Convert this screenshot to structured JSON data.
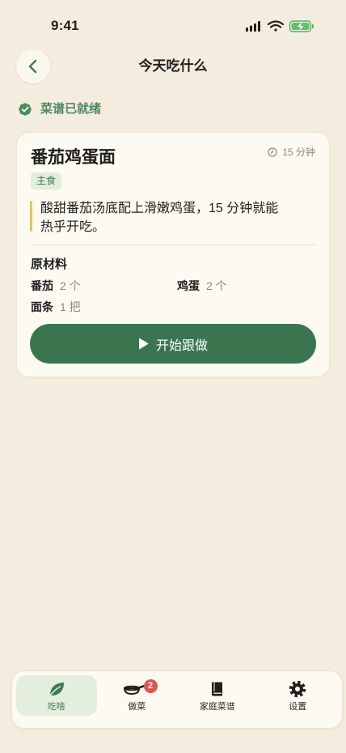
{
  "status_bar": {
    "time": "9:41",
    "icons": [
      "signal-icon",
      "wifi-icon",
      "battery-charging-icon"
    ]
  },
  "header": {
    "title": "今天吃什么",
    "back_icon": "chevron-left-icon"
  },
  "ready_status": {
    "text": "菜谱已就绪",
    "icon": "check-badge-icon"
  },
  "recipe": {
    "title": "番茄鸡蛋面",
    "time": "15 分钟",
    "time_icon": "clock-icon",
    "tag": "主食",
    "description": "酸甜番茄汤底配上滑嫩鸡蛋，15 分钟就能热乎开吃。",
    "ingredients_title": "原材料",
    "ingredients": [
      {
        "name": "番茄",
        "qty": "2 个"
      },
      {
        "name": "鸡蛋",
        "qty": "2 个"
      },
      {
        "name": "面条",
        "qty": "1 把"
      }
    ],
    "start_button": "开始跟做",
    "start_icon": "play-icon"
  },
  "tab_bar": {
    "items": [
      {
        "label": "吃啥",
        "icon": "leaf-icon",
        "active": true
      },
      {
        "label": "做菜",
        "icon": "frying-pan-icon",
        "badge": "2"
      },
      {
        "label": "家庭菜谱",
        "icon": "book-icon"
      },
      {
        "label": "设置",
        "icon": "gear-icon"
      }
    ]
  },
  "colors": {
    "background": "#F4EDDF",
    "card": "#FDFAF1",
    "accent": "#3A7550",
    "tag_bg": "#E2EDDB",
    "quote_bar": "#E8C55A",
    "badge": "#D9574A"
  }
}
